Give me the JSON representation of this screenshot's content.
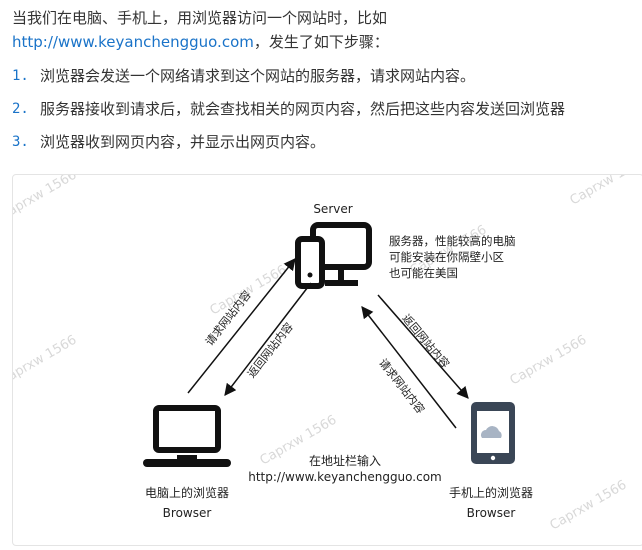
{
  "intro": {
    "line1": "当我们在电脑、手机上，用浏览器访问一个网站时，比如",
    "link": "http://www.keyanchengguo.com",
    "line2_suffix": "，发生了如下步骤："
  },
  "steps": [
    {
      "num": "1.",
      "text": "浏览器会发送一个网络请求到这个网站的服务器，请求网站内容。"
    },
    {
      "num": "2.",
      "text": "服务器接收到请求后，就会查找相关的网页内容，然后把这些内容发送回浏览器"
    },
    {
      "num": "3.",
      "text": "浏览器收到网页内容，并显示出网页内容。"
    }
  ],
  "diagram": {
    "server_title": "Server",
    "server_note": [
      "服务器，性能较高的电脑",
      "可能安装在你隔壁小区",
      "也可能在美国"
    ],
    "left_up": "请求网站内容",
    "left_down": "返回网站内容",
    "right_down": "返回网站内容",
    "right_up": "请求网站内容",
    "address_hint": "在地址栏输入",
    "address_url": "http://www.keyanchengguo.com",
    "pc_label": "电脑上的浏览器",
    "pc_sub": "Browser",
    "phone_label": "手机上的浏览器",
    "phone_sub": "Browser",
    "watermark": "Caprxw 1566",
    "icon_names": [
      "server-monitor-icon",
      "laptop-icon",
      "phone-cloud-icon"
    ]
  },
  "colors": {
    "link": "#1a73c8",
    "icon": "#111111",
    "phone": "#3a4656",
    "cloud": "#a8b4c4"
  }
}
